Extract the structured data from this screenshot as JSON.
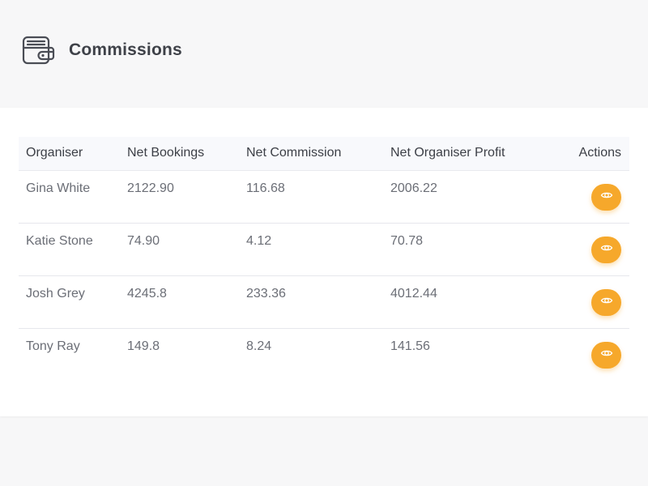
{
  "header": {
    "title": "Commissions",
    "icon": "wallet-icon"
  },
  "table": {
    "columns": [
      "Organiser",
      "Net Bookings",
      "Net Commission",
      "Net Organiser Profit",
      "Actions"
    ],
    "rows": [
      {
        "organiser": "Gina White",
        "net_bookings": "2122.90",
        "net_commission": "116.68",
        "net_profit": "2006.22",
        "action_icon": "eye-icon"
      },
      {
        "organiser": "Katie Stone",
        "net_bookings": "74.90",
        "net_commission": "4.12",
        "net_profit": "70.78",
        "action_icon": "eye-icon"
      },
      {
        "organiser": "Josh Grey",
        "net_bookings": "4245.8",
        "net_commission": "233.36",
        "net_profit": "4012.44",
        "action_icon": "eye-icon"
      },
      {
        "organiser": "Tony Ray",
        "net_bookings": "149.8",
        "net_commission": "8.24",
        "net_profit": "141.56",
        "action_icon": "eye-icon"
      }
    ]
  },
  "colors": {
    "accent": "#f6a82b",
    "background": "#f7f7f8",
    "card": "#ffffff",
    "header_row": "#f8f9fc"
  }
}
